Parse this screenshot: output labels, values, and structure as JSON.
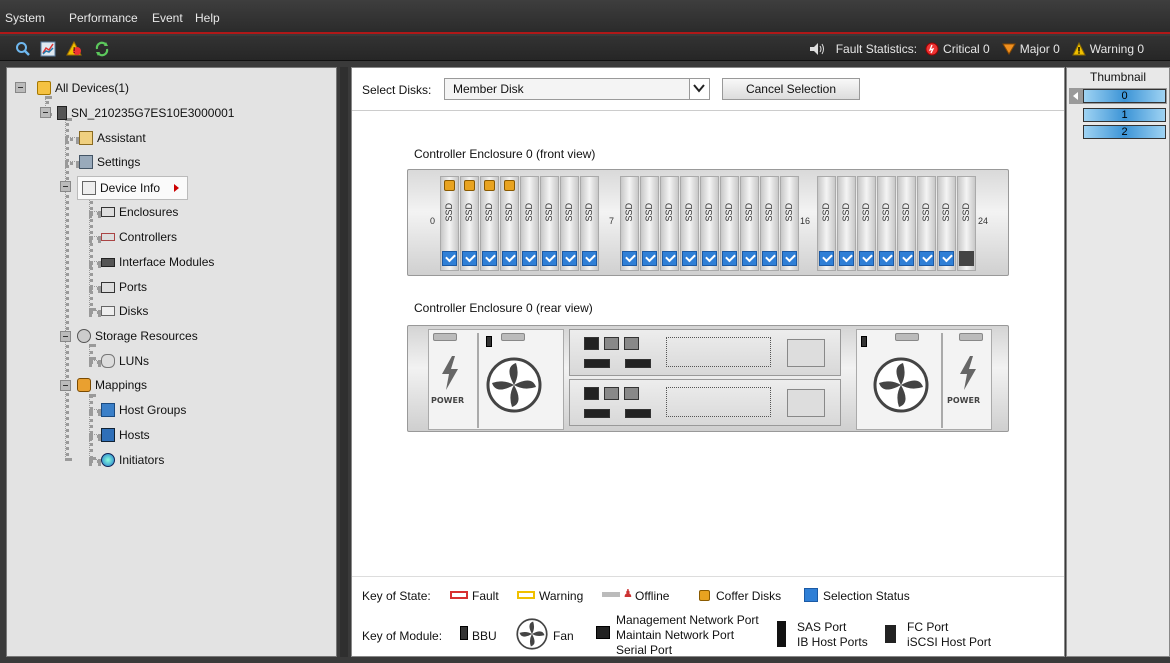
{
  "menu": {
    "items": [
      {
        "label": "System"
      },
      {
        "label": "Performance"
      },
      {
        "label": "Event"
      },
      {
        "label": "Help"
      }
    ]
  },
  "toolbar": {
    "icons": [
      "search-icon",
      "chart-icon",
      "alarm-icon",
      "refresh-icon"
    ]
  },
  "fault_stats": {
    "label": "Fault Statistics:",
    "critical": "Critical 0",
    "major": "Major 0",
    "warning": "Warning 0"
  },
  "tree": {
    "root": "All Devices(1)",
    "device": "SN_210235G7ES10E3000001",
    "items": {
      "assistant": "Assistant",
      "settings": "Settings",
      "device_info": "Device Info",
      "enclosures": "Enclosures",
      "controllers": "Controllers",
      "interface_modules": "Interface Modules",
      "ports": "Ports",
      "disks": "Disks",
      "storage_resources": "Storage Resources",
      "luns": "LUNs",
      "mappings": "Mappings",
      "host_groups": "Host Groups",
      "hosts": "Hosts",
      "initiators": "Initiators"
    }
  },
  "select_disks": {
    "label": "Select Disks:",
    "value": "Member Disk",
    "cancel": "Cancel Selection"
  },
  "front": {
    "title": "Controller Enclosure 0 (front view)",
    "disk_label": "SSD",
    "slot_markers": [
      "0",
      "7",
      "16",
      "24"
    ]
  },
  "rear": {
    "title": "Controller Enclosure 0 (rear view)",
    "power_label": "POWER"
  },
  "keys": {
    "state_label": "Key of State:",
    "fault": "Fault",
    "warning": "Warning",
    "offline": "Offline",
    "coffer": "Coffer Disks",
    "selection": "Selection Status",
    "module_label": "Key of Module:",
    "bbu": "BBU",
    "fan": "Fan",
    "mgmt_port": "Management Network Port",
    "maint_port": "Maintain Network Port",
    "serial_port": "Serial Port",
    "sas_port": "SAS Port",
    "ib_port": "IB Host Ports",
    "fc_port": "FC Port",
    "iscsi_port": "iSCSI Host Port"
  },
  "thumbnail": {
    "title": "Thumbnail",
    "pages": [
      "0",
      "1",
      "2"
    ]
  },
  "colors": {
    "menubar_accent": "#b01818",
    "selection": "#2f7fd6",
    "coffer": "#e8a320",
    "fault": "#d83030",
    "warning": "#f0c000"
  }
}
